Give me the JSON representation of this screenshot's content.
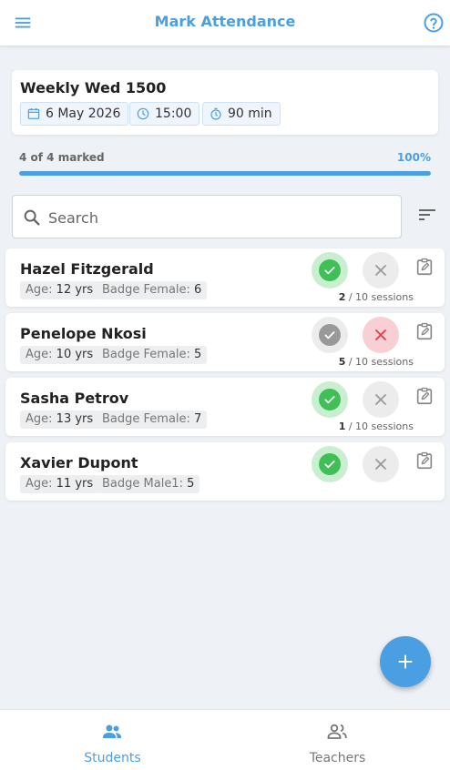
{
  "appbar": {
    "title": "Mark Attendance",
    "menu_icon": "menu-icon",
    "help_icon": "help-icon"
  },
  "session": {
    "name": "Weekly Wed 1500",
    "date": "6 May 2026",
    "time": "15:00",
    "duration": "90 min"
  },
  "progress": {
    "label": "4 of 4 marked",
    "percent_label": "100%",
    "fraction": 1.0
  },
  "search": {
    "placeholder": "Search",
    "value": ""
  },
  "students": [
    {
      "name": "Hazel Fitzgerald",
      "age_key": "Age:",
      "age": "12 yrs",
      "badge_key": "Badge Female:",
      "badge": "6",
      "status": "present",
      "sessions_count": "2",
      "sessions_total": "/ 10 sessions"
    },
    {
      "name": "Penelope Nkosi",
      "age_key": "Age:",
      "age": "10 yrs",
      "badge_key": "Badge Female:",
      "badge": "5",
      "status": "absent",
      "sessions_count": "5",
      "sessions_total": "/ 10 sessions"
    },
    {
      "name": "Sasha Petrov",
      "age_key": "Age:",
      "age": "13 yrs",
      "badge_key": "Badge Female:",
      "badge": "7",
      "status": "present",
      "sessions_count": "1",
      "sessions_total": "/ 10 sessions"
    },
    {
      "name": "Xavier Dupont",
      "age_key": "Age:",
      "age": "11 yrs",
      "badge_key": "Badge Male1:",
      "badge": "5",
      "status": "present",
      "sessions_count": "",
      "sessions_total": ""
    }
  ],
  "nav": {
    "students": "Students",
    "teachers": "Teachers",
    "active": "students"
  },
  "colors": {
    "accent": "#4a9fe3",
    "present": "#3fbf55",
    "absent": "#e53945"
  }
}
